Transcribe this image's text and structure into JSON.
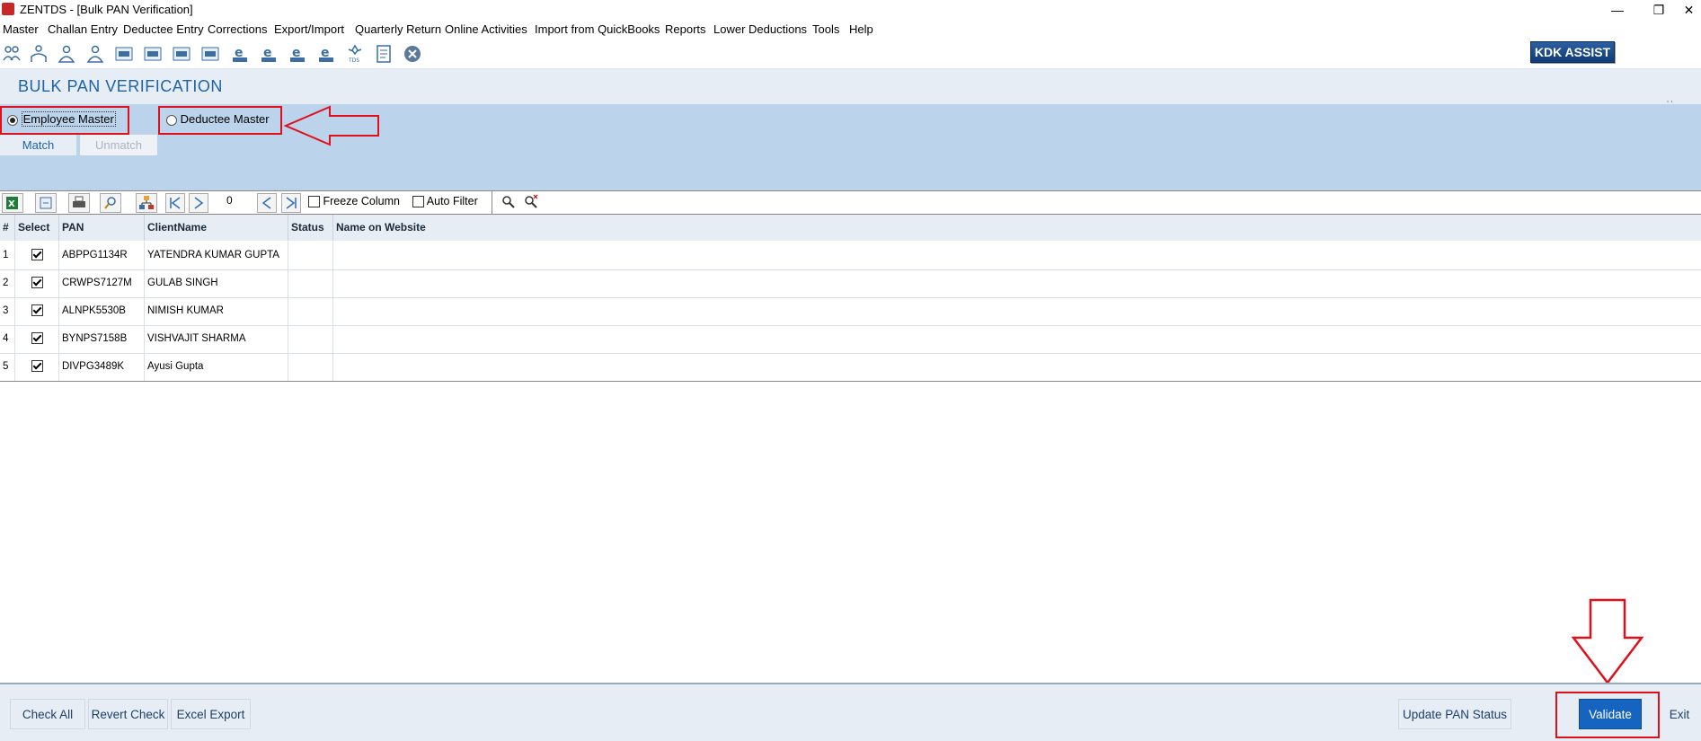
{
  "window": {
    "title": "ZENTDS - [Bulk PAN Verification]",
    "minimize": "—",
    "restore": "❐",
    "close": "✕"
  },
  "menu": [
    "Master",
    "Challan Entry",
    "Deductee Entry",
    "Corrections",
    "Export/Import",
    "Quarterly Return",
    "Online Activities",
    "Import from QuickBooks",
    "Reports",
    "Lower Deductions",
    "Tools",
    "Help"
  ],
  "toolbar": {
    "kdk_label": "KDK ASSIST",
    "icons": [
      "people-icon",
      "group-icon",
      "person-icon",
      "person-alt-icon",
      "form-24q-icon",
      "form-26q-icon",
      "form-27q-icon",
      "form-27eq-icon",
      "e-24q-icon",
      "e-26q-icon",
      "e-27q-icon",
      "e-27eq-icon",
      "tds-icon",
      "report-icon",
      "close-circle-icon"
    ]
  },
  "header": {
    "title": "BULK PAN VERIFICATION"
  },
  "options": {
    "employee_master": "Employee Master",
    "deductee_master": "Deductee Master",
    "selected": "Employee Master"
  },
  "tabs": {
    "match": "Match",
    "unmatch": "Unmatch"
  },
  "grid_toolbar": {
    "record_count": "0",
    "freeze_column": "Freeze Column",
    "auto_filter": "Auto Filter",
    "freeze_checked": false,
    "auto_filter_checked": false
  },
  "table": {
    "columns": [
      "#",
      "Select",
      "PAN",
      "ClientName",
      "Status",
      "Name on Website"
    ],
    "rows": [
      {
        "num": "1",
        "selected": true,
        "pan": "ABPPG1134R",
        "name": "YATENDRA KUMAR GUPTA",
        "status": "",
        "website": ""
      },
      {
        "num": "2",
        "selected": true,
        "pan": "CRWPS7127M",
        "name": "GULAB SINGH",
        "status": "",
        "website": ""
      },
      {
        "num": "3",
        "selected": true,
        "pan": "ALNPK5530B",
        "name": "NIMISH KUMAR",
        "status": "",
        "website": ""
      },
      {
        "num": "4",
        "selected": true,
        "pan": "BYNPS7158B",
        "name": "VISHVAJIT SHARMA",
        "status": "",
        "website": ""
      },
      {
        "num": "5",
        "selected": true,
        "pan": "DIVPG3489K",
        "name": "Ayusi Gupta",
        "status": "",
        "website": ""
      }
    ]
  },
  "bottom": {
    "check_all": "Check All",
    "revert_check": "Revert Check",
    "excel_export": "Excel Export",
    "update_pan_status": "Update PAN Status",
    "validate": "Validate",
    "exit": "Exit"
  },
  "colors": {
    "accent_blue": "#1565c0",
    "annotation_red": "#e0101a",
    "panel_blue": "#bcd3ec"
  }
}
